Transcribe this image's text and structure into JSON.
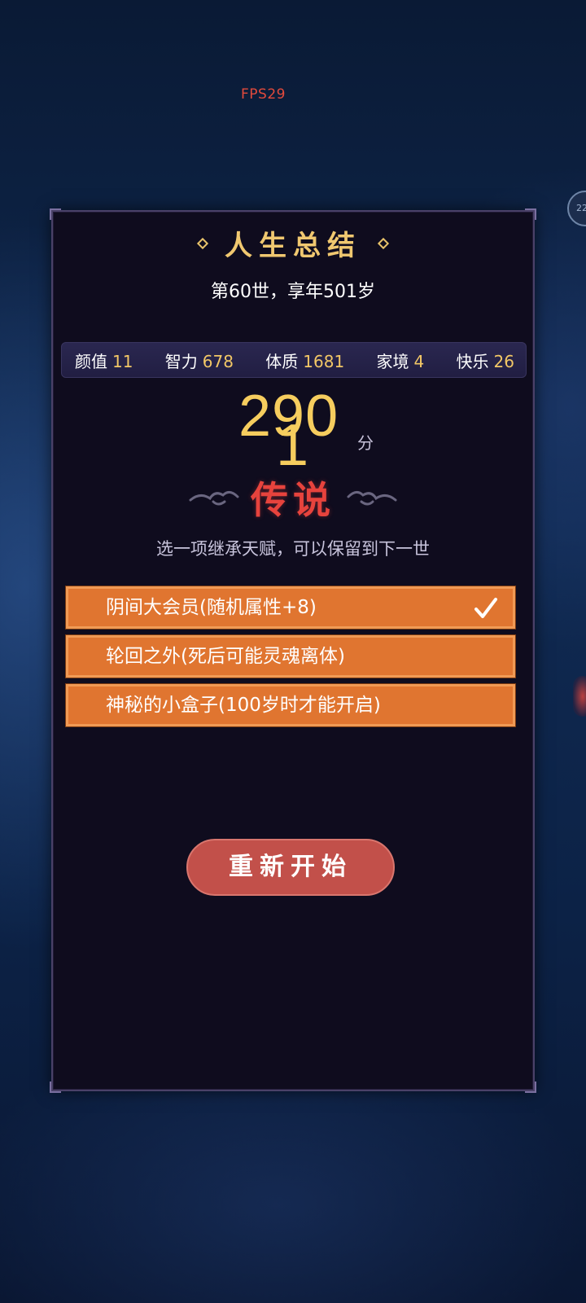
{
  "overlay": {
    "fps": "FPS29",
    "side_badge": "22"
  },
  "panel": {
    "title": "人生总结",
    "subtitle": "第60世，享年501岁",
    "stats": [
      {
        "label": "颜值",
        "value": "11"
      },
      {
        "label": "智力",
        "value": "678"
      },
      {
        "label": "体质",
        "value": "1681"
      },
      {
        "label": "家境",
        "value": "4"
      },
      {
        "label": "快乐",
        "value": "26"
      }
    ],
    "score": {
      "value": "290",
      "rolling_digit": "1",
      "unit": "分"
    },
    "rank": "传说",
    "inherit_tip": "选一项继承天赋，可以保留到下一世",
    "talents": [
      {
        "label": "阴间大会员(随机属性+8)",
        "selected": true
      },
      {
        "label": "轮回之外(死后可能灵魂离体)",
        "selected": false
      },
      {
        "label": "神秘的小盒子(100岁时才能开启)",
        "selected": false
      }
    ],
    "restart_label": "重新开始"
  },
  "colors": {
    "accent_gold": "#f0c870",
    "rank_red": "#e7433d",
    "talent_orange": "#e07530",
    "restart_red": "#c2504a"
  },
  "icons": [
    "diamond-ornament-icon",
    "cloud-ornament-icon",
    "check-icon"
  ]
}
